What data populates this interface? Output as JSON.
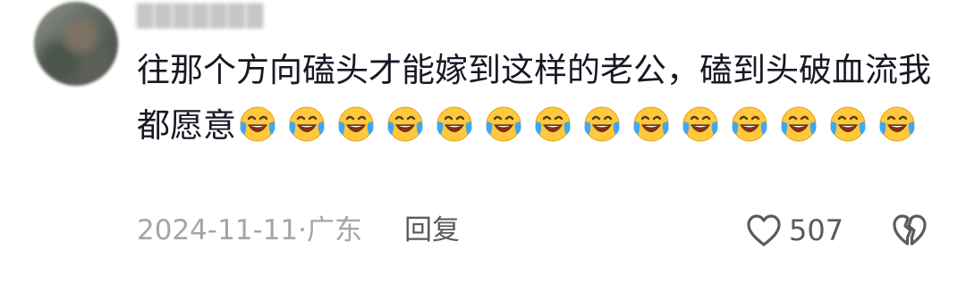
{
  "comment": {
    "username": "███████",
    "text": "往那个方向磕头才能嫁到这样的老公，磕到头破血流我都愿意",
    "emoji": "laughing-crying-emoji",
    "emoji_count": 14,
    "date": "2024-11-11",
    "separator": "·",
    "location": "广东",
    "reply_label": "回复",
    "like_count": "507"
  },
  "icons": {
    "like": "heart-outline-icon",
    "dislike": "broken-heart-icon"
  },
  "colors": {
    "text": "#161823",
    "meta": "#a5a5a8",
    "action": "#5a5a60",
    "emoji_face": "#ffc83d",
    "emoji_tears": "#3ea7f0"
  }
}
